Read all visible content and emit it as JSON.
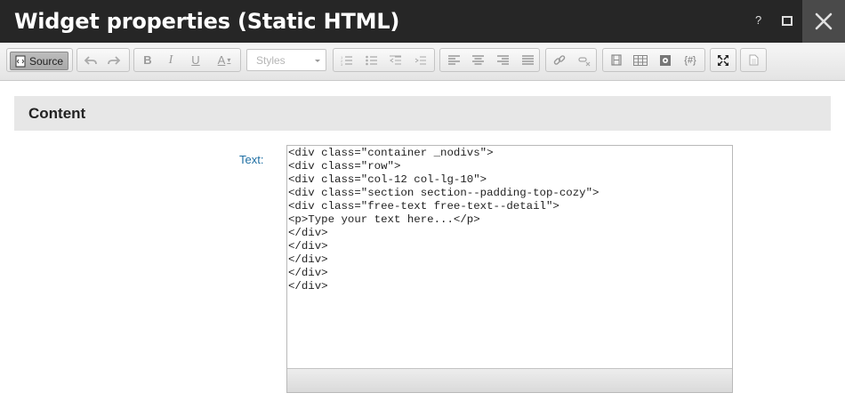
{
  "window": {
    "title": "Widget properties (Static HTML)",
    "help_label": "?",
    "help_icon": "question-mark",
    "maximize_icon": "maximize-square",
    "close_icon": "x-close"
  },
  "toolbar": {
    "source_label": "Source",
    "styles_placeholder": "Styles",
    "buttons": [
      {
        "name": "undo-icon",
        "glyph": "↶"
      },
      {
        "name": "redo-icon",
        "glyph": "↷"
      },
      {
        "name": "bold-icon",
        "glyph": "B"
      },
      {
        "name": "italic-icon",
        "glyph": "I"
      },
      {
        "name": "underline-icon",
        "glyph": "U"
      },
      {
        "name": "text-color-icon",
        "glyph": "A"
      },
      {
        "name": "numbered-list-icon",
        "glyph": "≡"
      },
      {
        "name": "bulleted-list-icon",
        "glyph": "≡"
      },
      {
        "name": "decrease-indent-icon",
        "glyph": "⇤"
      },
      {
        "name": "increase-indent-icon",
        "glyph": "⇥"
      },
      {
        "name": "align-left-icon",
        "glyph": "≡"
      },
      {
        "name": "align-center-icon",
        "glyph": "≡"
      },
      {
        "name": "align-right-icon",
        "glyph": "≡"
      },
      {
        "name": "justify-icon",
        "glyph": "≡"
      },
      {
        "name": "link-icon",
        "glyph": "⛓"
      },
      {
        "name": "unlink-icon",
        "glyph": "⛓"
      },
      {
        "name": "media-icon",
        "glyph": "▤"
      },
      {
        "name": "table-icon",
        "glyph": "▦"
      },
      {
        "name": "widget-icon",
        "glyph": "⚙"
      },
      {
        "name": "macro-icon",
        "glyph": "{#}"
      },
      {
        "name": "maximize-editor-icon",
        "glyph": "⤢"
      },
      {
        "name": "document-icon",
        "glyph": "▯"
      }
    ]
  },
  "content": {
    "section_title": "Content",
    "text_label": "Text:",
    "text_value": "<div class=\"container _nodivs\">\n<div class=\"row\">\n<div class=\"col-12 col-lg-10\">\n<div class=\"section section--padding-top-cozy\">\n<div class=\"free-text free-text--detail\">\n<p>Type your text here...</p>\n</div>\n</div>\n</div>\n</div>\n</div>"
  },
  "colors": {
    "titlebar_bg": "#262626",
    "label_blue": "#1f6fa3",
    "section_bg": "#e7e7e7"
  }
}
